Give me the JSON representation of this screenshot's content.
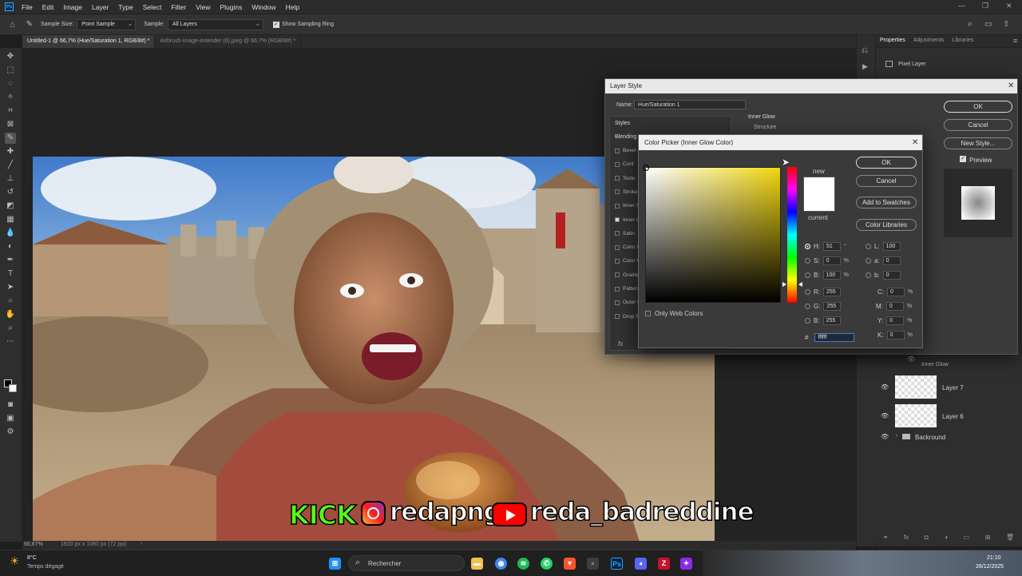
{
  "menubar": {
    "items": [
      "File",
      "Edit",
      "Image",
      "Layer",
      "Type",
      "Select",
      "Filter",
      "View",
      "Plugins",
      "Window",
      "Help"
    ]
  },
  "options": {
    "sample_size_label": "Sample Size:",
    "sample_size_value": "Point Sample",
    "sample_label": "Sample:",
    "sample_value": "All Layers",
    "show_ring_label": "Show Sampling Ring"
  },
  "doc_tabs": [
    {
      "label": "Untitled-1 @ 66,7% (Hue/Saturation 1, RGB/8#) *"
    },
    {
      "label": "Airbrush-image-extender (6).jpeg @ 66,7% (RGB/8#) *"
    }
  ],
  "status": {
    "zoom": "66,67%",
    "doc_info": "1920 px x 1080 px (72 ppi)"
  },
  "panel": {
    "tabs": [
      "Properties",
      "Adjustments",
      "Libraries"
    ],
    "pixel_layer": "Pixel Layer"
  },
  "layers": {
    "effect_label": "Inner Glow",
    "items": [
      "Layer 7",
      "Layer 6",
      "Backround"
    ]
  },
  "layer_style": {
    "title": "Layer Style",
    "name_label": "Name:",
    "name_value": "Hue/Saturation 1",
    "section_title": "Inner Glow",
    "section_sub": "Structure",
    "styles_header": "Styles",
    "blending_label": "Blending O",
    "list": [
      "Bevel & ",
      "Cont",
      "Textu",
      "Stroke",
      "Inner S",
      "Inner G",
      "Satin",
      "Color O",
      "Color O",
      "Gradien",
      "Pattern",
      "Outer G",
      "Drop S"
    ],
    "fx_label": "fx",
    "ok": "OK",
    "cancel": "Cancel",
    "new_style": "New Style...",
    "preview": "Preview"
  },
  "color_picker": {
    "title": "Color Picker (Inner Glow Color)",
    "ok": "OK",
    "cancel": "Cancel",
    "add_swatches": "Add to Swatches",
    "color_libraries": "Color Libraries",
    "new_label": "new",
    "current_label": "current",
    "only_web": "Only Web Colors",
    "new_color": "#ffffff",
    "current_color": "#ffffff",
    "hue_color": "#f2d60e",
    "hsb": [
      {
        "label": "H:",
        "value": "51",
        "unit": "°"
      },
      {
        "label": "S:",
        "value": "0",
        "unit": "%"
      },
      {
        "label": "B:",
        "value": "100",
        "unit": "%"
      }
    ],
    "rgb": [
      {
        "label": "R:",
        "value": "255"
      },
      {
        "label": "G:",
        "value": "255"
      },
      {
        "label": "B:",
        "value": "255"
      }
    ],
    "lab": [
      {
        "label": "L:",
        "value": "100"
      },
      {
        "label": "a:",
        "value": "0"
      },
      {
        "label": "b:",
        "value": "0"
      }
    ],
    "cmyk": [
      {
        "label": "C:",
        "value": "0",
        "unit": "%"
      },
      {
        "label": "M:",
        "value": "0",
        "unit": "%"
      },
      {
        "label": "Y:",
        "value": "0",
        "unit": "%"
      },
      {
        "label": "K:",
        "value": "0",
        "unit": "%"
      }
    ],
    "hex_label": "#",
    "hex": "ffffff"
  },
  "overlay": {
    "kick": "KICK",
    "instagram": "redapng",
    "youtube": "reda_badreddine"
  },
  "taskbar": {
    "temp": "8°C",
    "weather": "Temps dégagé",
    "search": "Rechercher",
    "time": "21:10",
    "date": "26/12/2025"
  }
}
